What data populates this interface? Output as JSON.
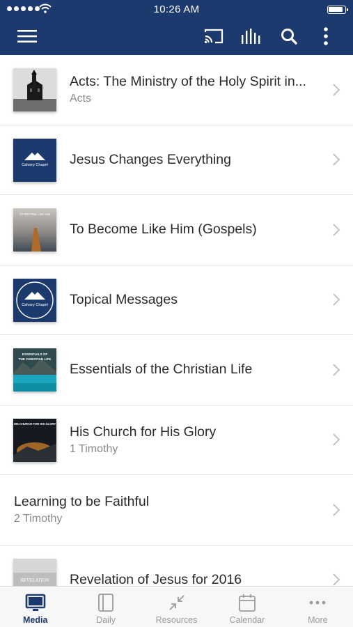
{
  "status_bar": {
    "time": "10:26 AM"
  },
  "nav": {
    "icons": [
      "menu-icon",
      "cast-icon",
      "audio-bars-icon",
      "search-icon",
      "more-vertical-icon"
    ]
  },
  "list": {
    "items": [
      {
        "title": "Acts: The Ministry of the Holy Spirit in...",
        "subtitle": "Acts",
        "thumbnail": "church-photo"
      },
      {
        "title": "Jesus Changes Everything",
        "subtitle": "",
        "thumbnail": "calvary-chapel-logo-square"
      },
      {
        "title": "To Become Like Him (Gospels)",
        "subtitle": "",
        "thumbnail": "to-become-like-him-art"
      },
      {
        "title": "Topical Messages",
        "subtitle": "",
        "thumbnail": "calvary-chapel-logo-circle"
      },
      {
        "title": "Essentials of the Christian Life",
        "subtitle": "",
        "thumbnail": "essentials-lake-art"
      },
      {
        "title": "His Church for His Glory",
        "subtitle": "1 Timothy",
        "thumbnail": "his-church-art"
      },
      {
        "title": "Learning to be Faithful",
        "subtitle": "2 Timothy",
        "thumbnail": ""
      },
      {
        "title": "Revelation of Jesus for 2016",
        "subtitle": "",
        "thumbnail": "revelation-art"
      }
    ],
    "thumb_text": {
      "calvary_square": "Calvary Chapel",
      "calvary_circle": "Calvary Chapel",
      "to_become": "TO BECOME LIKE HIM",
      "essentials_line1": "ESSENTIALS OF",
      "essentials_line2": "THE CHRISTIAN LIFE",
      "his_church": "HIS CHURCH FOR HIS GLORY",
      "revelation": "REVELATION"
    }
  },
  "tabbar": {
    "tabs": [
      {
        "label": "Media",
        "icon": "monitor-icon",
        "active": true
      },
      {
        "label": "Daily",
        "icon": "book-icon",
        "active": false
      },
      {
        "label": "Resources",
        "icon": "collapse-arrows-icon",
        "active": false
      },
      {
        "label": "Calendar",
        "icon": "calendar-icon",
        "active": false
      },
      {
        "label": "More",
        "icon": "ellipsis-icon",
        "active": false
      }
    ]
  },
  "colors": {
    "nav_bg": "#1d3a6e",
    "active_tab": "#1d3a6e",
    "inactive_tab": "#9a9a9a"
  }
}
